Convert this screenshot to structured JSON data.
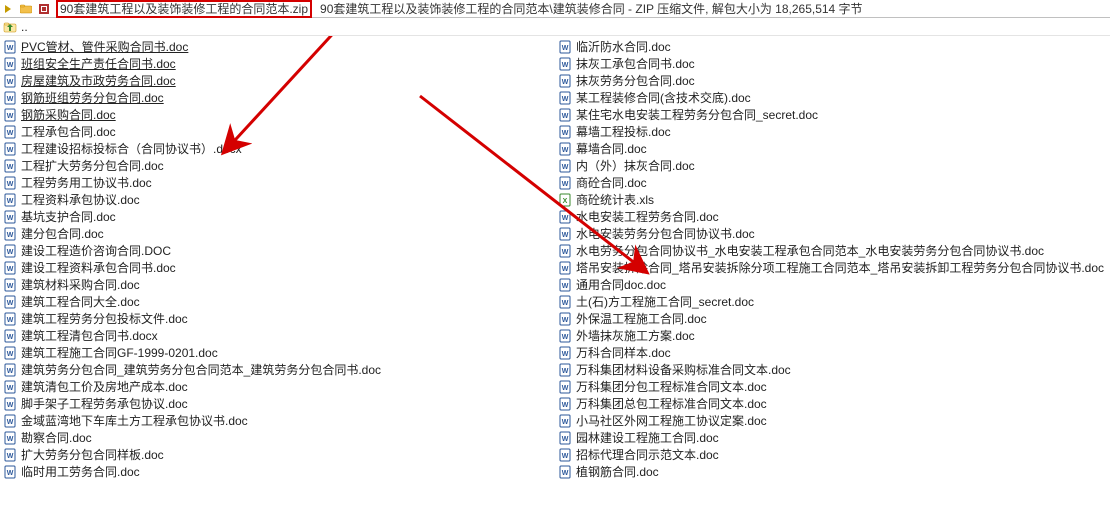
{
  "topbar": {
    "archive_name": "90套建筑工程以及装饰装修工程的合同范本.zip",
    "path_info": "90套建筑工程以及装饰装修工程的合同范本\\建筑装修合同 - ZIP 压缩文件, 解包大小为 18,265,514 字节"
  },
  "up": {
    "label": ".."
  },
  "left": [
    {
      "name": "PVC管材、管件采购合同书.doc",
      "type": "doc",
      "underline": true
    },
    {
      "name": "班组安全生产责任合同书.doc",
      "type": "doc",
      "underline": true
    },
    {
      "name": "房屋建筑及市政劳务合同.doc",
      "type": "doc",
      "underline": true
    },
    {
      "name": "钢筋班组劳务分包合同.doc",
      "type": "doc",
      "underline": true
    },
    {
      "name": "钢筋采购合同.doc",
      "type": "doc",
      "underline": true
    },
    {
      "name": "工程承包合同.doc",
      "type": "doc"
    },
    {
      "name": "工程建设招标投标合（合同协议书）.docx",
      "type": "docx"
    },
    {
      "name": "工程扩大劳务分包合同.doc",
      "type": "doc"
    },
    {
      "name": "工程劳务用工协议书.doc",
      "type": "doc"
    },
    {
      "name": "工程资料承包协议.doc",
      "type": "doc"
    },
    {
      "name": "基坑支护合同.doc",
      "type": "doc"
    },
    {
      "name": "建分包合同.doc",
      "type": "doc"
    },
    {
      "name": "建设工程造价咨询合同.DOC",
      "type": "doc"
    },
    {
      "name": "建设工程资料承包合同书.doc",
      "type": "doc"
    },
    {
      "name": "建筑材料采购合同.doc",
      "type": "doc"
    },
    {
      "name": "建筑工程合同大全.doc",
      "type": "doc"
    },
    {
      "name": "建筑工程劳务分包投标文件.doc",
      "type": "doc"
    },
    {
      "name": "建筑工程清包合同书.docx",
      "type": "docx"
    },
    {
      "name": "建筑工程施工合同GF-1999-0201.doc",
      "type": "doc"
    },
    {
      "name": "建筑劳务分包合同_建筑劳务分包合同范本_建筑劳务分包合同书.doc",
      "type": "doc"
    },
    {
      "name": "建筑清包工价及房地产成本.doc",
      "type": "doc"
    },
    {
      "name": "脚手架子工程劳务承包协议.doc",
      "type": "doc"
    },
    {
      "name": "金域蓝湾地下车库土方工程承包协议书.doc",
      "type": "doc"
    },
    {
      "name": "勘察合同.doc",
      "type": "doc"
    },
    {
      "name": "扩大劳务分包合同样板.doc",
      "type": "doc"
    },
    {
      "name": "临时用工劳务合同.doc",
      "type": "doc"
    }
  ],
  "right": [
    {
      "name": "临沂防水合同.doc",
      "type": "doc"
    },
    {
      "name": "抹灰工承包合同书.doc",
      "type": "doc"
    },
    {
      "name": "抹灰劳务分包合同.doc",
      "type": "doc"
    },
    {
      "name": "某工程装修合同(含技术交底).doc",
      "type": "doc"
    },
    {
      "name": "某住宅水电安装工程劳务分包合同_secret.doc",
      "type": "doc"
    },
    {
      "name": "幕墙工程投标.doc",
      "type": "doc"
    },
    {
      "name": "幕墙合同.doc",
      "type": "doc"
    },
    {
      "name": "内（外）抹灰合同.doc",
      "type": "doc"
    },
    {
      "name": "商砼合同.doc",
      "type": "doc"
    },
    {
      "name": "商砼统计表.xls",
      "type": "xls"
    },
    {
      "name": "水电安装工程劳务合同.doc",
      "type": "doc"
    },
    {
      "name": "水电安装劳务分包合同协议书.doc",
      "type": "doc"
    },
    {
      "name": "水电劳务分包合同协议书_水电安装工程承包合同范本_水电安装劳务分包合同协议书.doc",
      "type": "doc"
    },
    {
      "name": "塔吊安装拆除合同_塔吊安装拆除分项工程施工合同范本_塔吊安装拆卸工程劳务分包合同协议书.doc",
      "type": "doc"
    },
    {
      "name": "通用合同doc.doc",
      "type": "doc"
    },
    {
      "name": "土(石)方工程施工合同_secret.doc",
      "type": "doc"
    },
    {
      "name": "外保温工程施工合同.doc",
      "type": "doc"
    },
    {
      "name": "外墙抹灰施工方案.doc",
      "type": "doc"
    },
    {
      "name": "万科合同样本.doc",
      "type": "doc"
    },
    {
      "name": "万科集团材料设备采购标准合同文本.doc",
      "type": "doc"
    },
    {
      "name": "万科集团分包工程标准合同文本.doc",
      "type": "doc"
    },
    {
      "name": "万科集团总包工程标准合同文本.doc",
      "type": "doc"
    },
    {
      "name": "小马社区外网工程施工协议定案.doc",
      "type": "doc"
    },
    {
      "name": "园林建设工程施工合同.doc",
      "type": "doc"
    },
    {
      "name": "招标代理合同示范文本.doc",
      "type": "doc"
    },
    {
      "name": "植钢筋合同.doc",
      "type": "doc"
    }
  ]
}
